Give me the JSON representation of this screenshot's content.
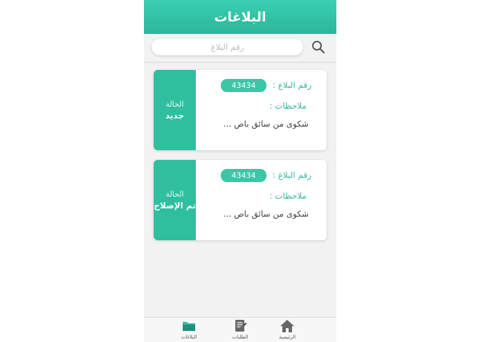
{
  "header": {
    "title": "البلاغات"
  },
  "search": {
    "placeholder": "رقم البلاغ"
  },
  "reports": [
    {
      "report_label": "رقم البلاغ :",
      "report_number": "43434",
      "notes_label": "ملاحظات :",
      "notes_text": "شكوى من سائق باص ...",
      "status_label": "الحالة",
      "status_value": "جديد"
    },
    {
      "report_label": "رقم البلاغ :",
      "report_number": "43434",
      "notes_label": "ملاحظات :",
      "notes_text": "شكوى من سائق باص ...",
      "status_label": "الحالة",
      "status_value": "تم الإصلاح"
    }
  ],
  "bottom_nav": {
    "items": [
      {
        "label": "البلاغات",
        "icon": "folder-icon"
      },
      {
        "label": "الطلبات",
        "icon": "document-edit-icon"
      },
      {
        "label": "الرئيسية",
        "icon": "home-icon"
      }
    ]
  },
  "colors": {
    "accent": "#2fbf9f",
    "header": "#34c2a6",
    "background": "#f2f2f2"
  }
}
